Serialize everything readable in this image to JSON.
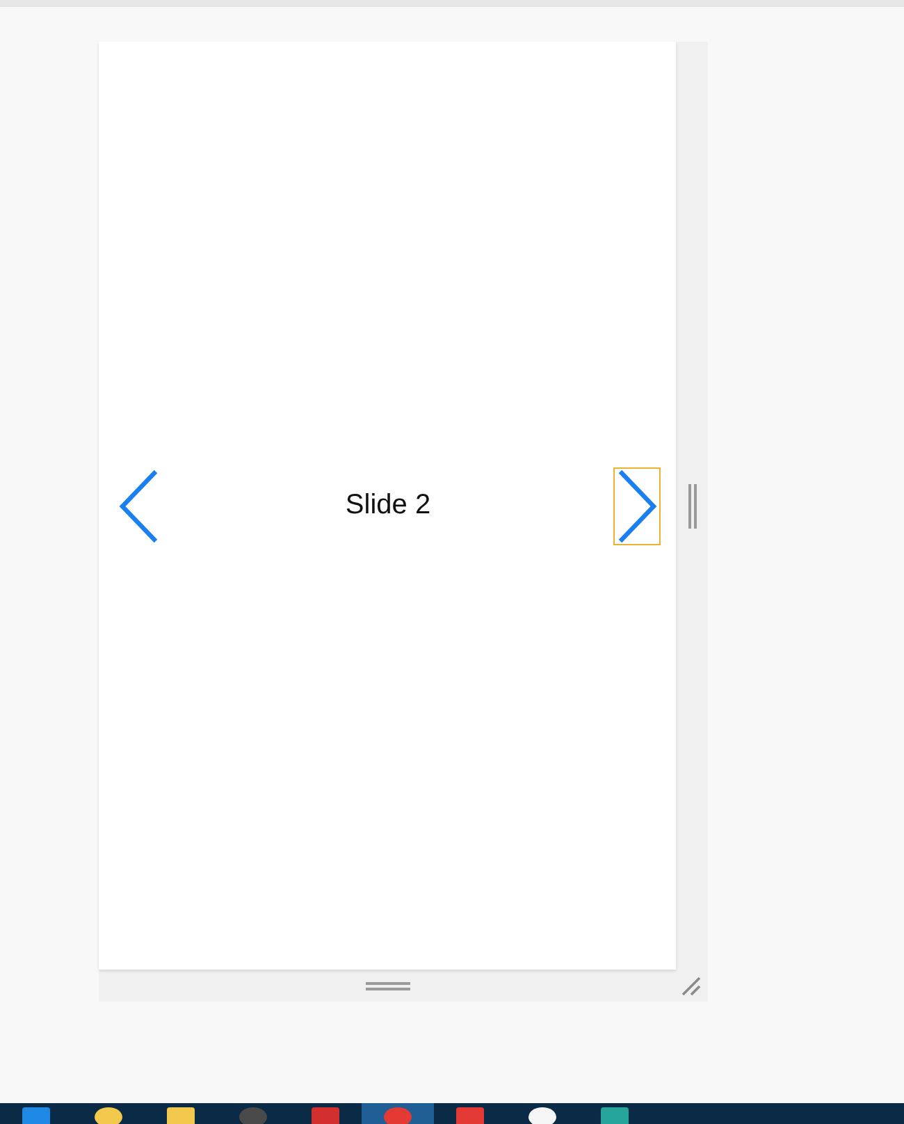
{
  "slide": {
    "text": "Slide 2"
  },
  "prev_button": {
    "focused": false
  },
  "next_button": {
    "focused": true
  },
  "taskbar": {
    "items": [
      {
        "color": "#1e88e5",
        "selected": false
      },
      {
        "color": "#f2c94c",
        "selected": false
      },
      {
        "color": "#f2c94c",
        "selected": false
      },
      {
        "color": "#4a4a4a",
        "selected": false
      },
      {
        "color": "#d32f2f",
        "selected": false
      },
      {
        "color": "#e53935",
        "selected": true
      },
      {
        "color": "#e53935",
        "selected": false
      },
      {
        "color": "#f5f5f5",
        "selected": false
      },
      {
        "color": "#26a69a",
        "selected": false
      }
    ]
  }
}
